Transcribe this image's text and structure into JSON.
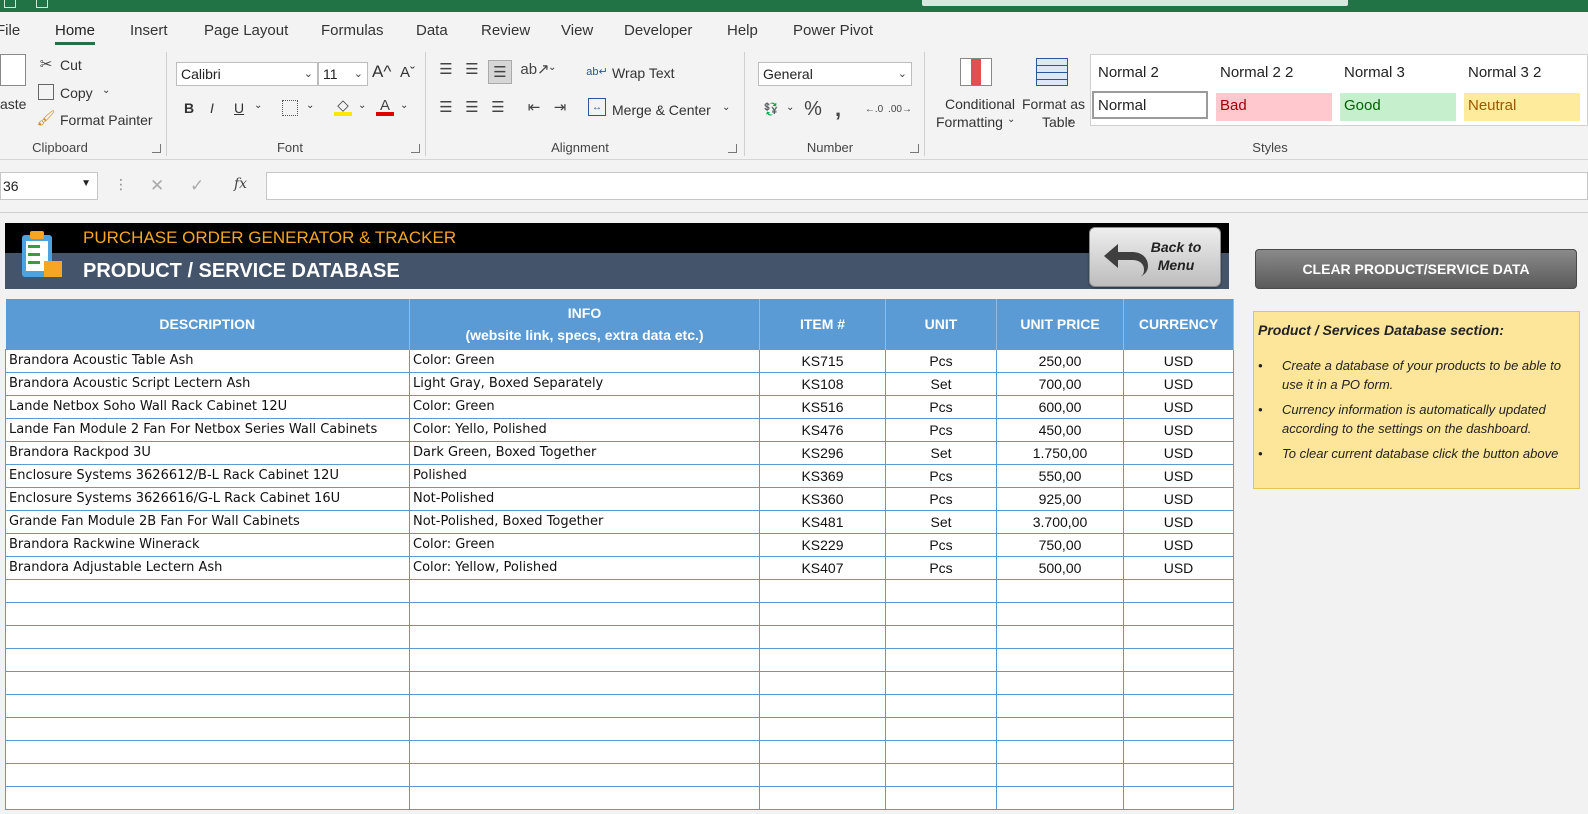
{
  "menu": {
    "tabs": [
      "File",
      "Home",
      "Insert",
      "Page Layout",
      "Formulas",
      "Data",
      "Review",
      "View",
      "Developer",
      "Help",
      "Power Pivot"
    ],
    "active": "Home"
  },
  "ribbon": {
    "clipboard": {
      "paste_label": "aste",
      "cut_label": "Cut",
      "copy_label": "Copy",
      "format_painter_label": "Format Painter",
      "group_label": "Clipboard"
    },
    "font": {
      "font_name": "Calibri",
      "font_size": "11",
      "bold": "B",
      "italic": "I",
      "underline": "U",
      "group_label": "Font"
    },
    "alignment": {
      "wrap_text_label": "Wrap Text",
      "merge_label": "Merge & Center",
      "group_label": "Alignment"
    },
    "number": {
      "format": "General",
      "group_label": "Number"
    },
    "styles": {
      "conditional_line1": "Conditional",
      "conditional_line2": "Formatting",
      "format_table_line1": "Format as",
      "format_table_line2": "Table",
      "style_names": [
        "Normal 2",
        "Normal 2 2",
        "Normal 3",
        "Normal 3 2"
      ],
      "cells": [
        {
          "label": "Normal",
          "bg": "#ffffff",
          "fg": "#222222"
        },
        {
          "label": "Bad",
          "bg": "#ffc7ce",
          "fg": "#9c0006"
        },
        {
          "label": "Good",
          "bg": "#c6efce",
          "fg": "#006100"
        },
        {
          "label": "Neutral",
          "bg": "#ffeb9c",
          "fg": "#9c5700"
        }
      ],
      "group_label": "Styles"
    }
  },
  "formula_bar": {
    "name_box": "36",
    "fx": "fx",
    "value": ""
  },
  "sheet": {
    "app_title": "PURCHASE ORDER GENERATOR & TRACKER",
    "page_title": "PRODUCT / SERVICE DATABASE",
    "back_button": {
      "line1": "Back to",
      "line2": "Menu"
    },
    "clear_button": "CLEAR  PRODUCT/SERVICE DATA",
    "notes": {
      "title": "Product / Services Database section:",
      "bullets": [
        "Create a database of your products to be able to use it in a PO form.",
        "Currency information is automatically updated according to the settings on the dashboard.",
        "To clear current database click the button above"
      ]
    },
    "table": {
      "headers": {
        "description": "DESCRIPTION",
        "info_line1": "INFO",
        "info_line2": "(website link, specs, extra data etc.)",
        "item": "ITEM #",
        "unit": "UNIT",
        "unit_price": "UNIT PRICE",
        "currency": "CURRENCY"
      },
      "rows": [
        {
          "desc": "Brandora Acoustic Table Ash",
          "info": "Color: Green",
          "item": "KS715",
          "unit": "Pcs",
          "price": "250,00",
          "cur": "USD"
        },
        {
          "desc": "Brandora Acoustic Script Lectern Ash",
          "info": "Light Gray, Boxed Separately",
          "item": "KS108",
          "unit": "Set",
          "price": "700,00",
          "cur": "USD"
        },
        {
          "desc": "Lande Netbox Soho Wall Rack Cabinet 12U",
          "info": "Color: Green",
          "item": "KS516",
          "unit": "Pcs",
          "price": "600,00",
          "cur": "USD"
        },
        {
          "desc": "Lande Fan Module 2 Fan For Netbox Series Wall Cabinets",
          "info": "Color: Yello, Polished",
          "item": "KS476",
          "unit": "Pcs",
          "price": "450,00",
          "cur": "USD"
        },
        {
          "desc": "Brandora Rackpod 3U",
          "info": "Dark Green, Boxed Together",
          "item": "KS296",
          "unit": "Set",
          "price": "1.750,00",
          "cur": "USD"
        },
        {
          "desc": "Enclosure Systems 3626612/B-L Rack Cabinet 12U",
          "info": "Polished",
          "item": "KS369",
          "unit": "Pcs",
          "price": "550,00",
          "cur": "USD"
        },
        {
          "desc": "Enclosure Systems 3626616/G-L Rack Cabinet 16U",
          "info": "Not-Polished",
          "item": "KS360",
          "unit": "Pcs",
          "price": "925,00",
          "cur": "USD"
        },
        {
          "desc": "Grande Fan Module 2B Fan For Wall Cabinets",
          "info": "Not-Polished, Boxed Together",
          "item": "KS481",
          "unit": "Set",
          "price": "3.700,00",
          "cur": "USD"
        },
        {
          "desc": "Brandora Rackwine Winerack",
          "info": "Color: Green",
          "item": "KS229",
          "unit": "Pcs",
          "price": "750,00",
          "cur": "USD"
        },
        {
          "desc": "Brandora Adjustable Lectern Ash",
          "info": "Color: Yellow, Polished",
          "item": "KS407",
          "unit": "Pcs",
          "price": "500,00",
          "cur": "USD"
        }
      ],
      "empty_rows": 10
    }
  }
}
